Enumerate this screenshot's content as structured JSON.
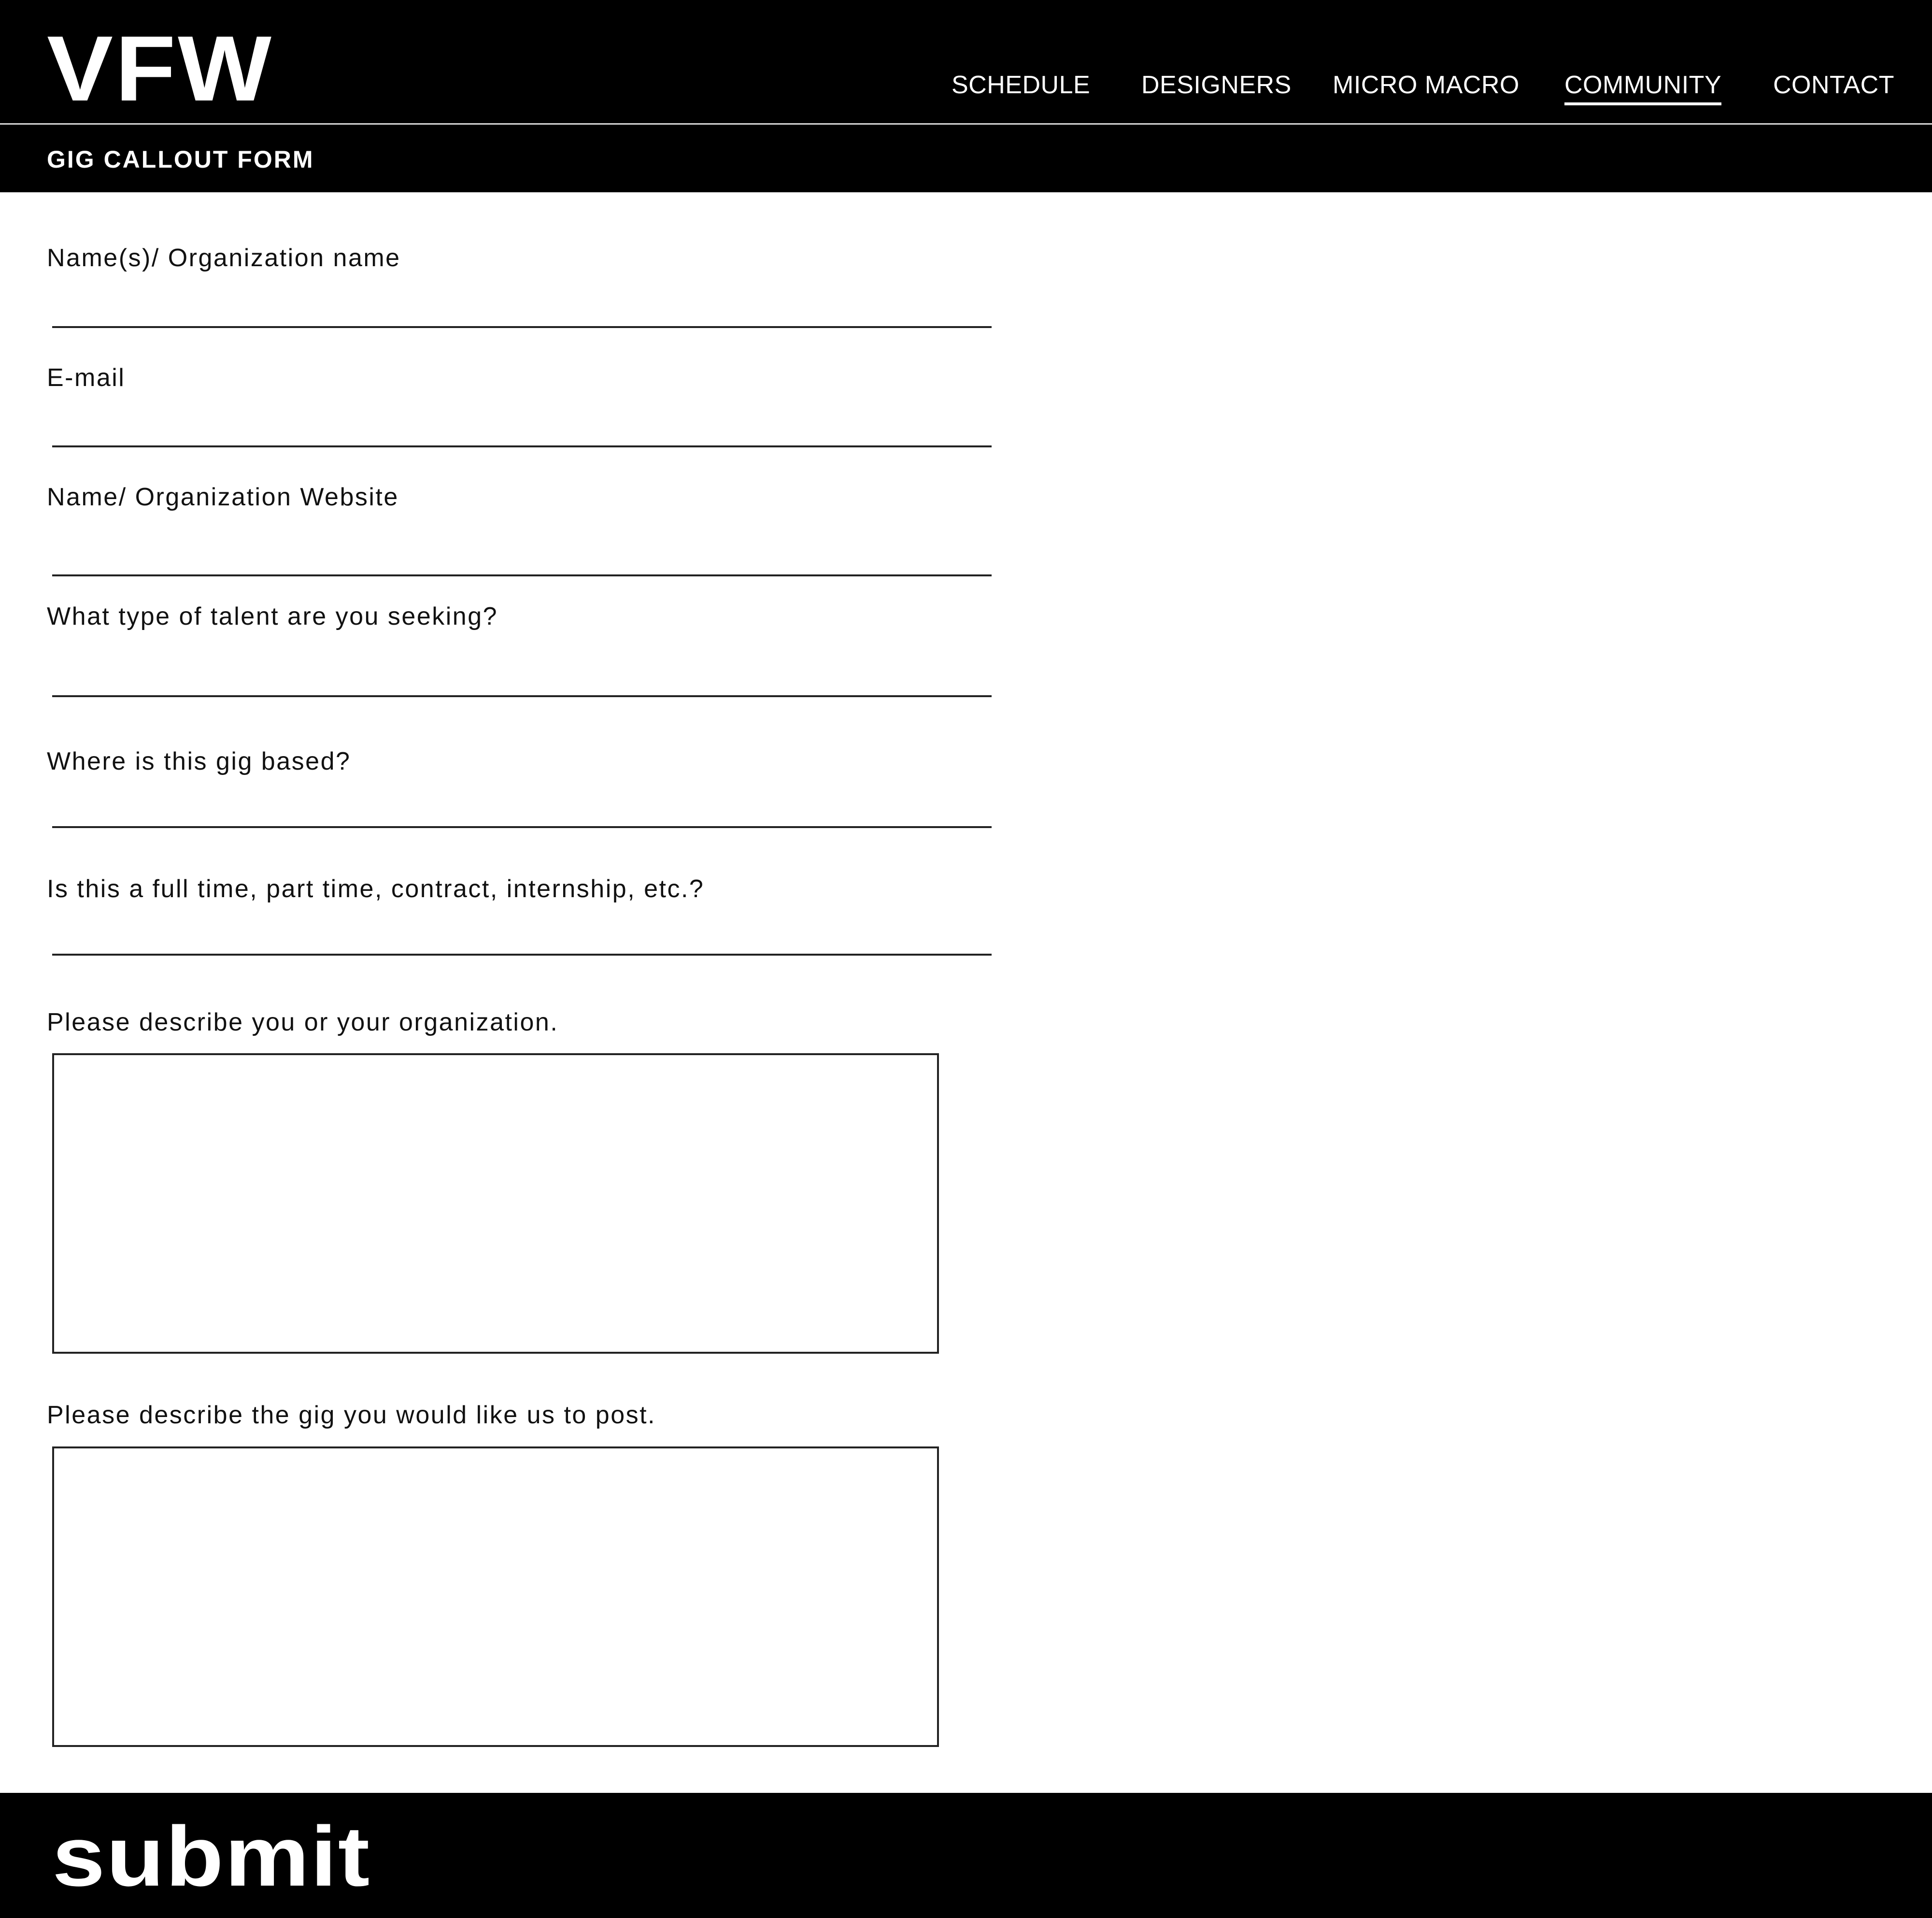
{
  "header": {
    "logo": "VFW",
    "nav": [
      {
        "label": "SCHEDULE",
        "active": false
      },
      {
        "label": "DESIGNERS",
        "active": false
      },
      {
        "label": "MICRO MACRO",
        "active": false
      },
      {
        "label": "COMMUNITY",
        "active": true
      },
      {
        "label": "CONTACT",
        "active": false
      }
    ]
  },
  "page": {
    "title": "GIG CALLOUT FORM"
  },
  "form": {
    "fields": [
      {
        "label": "Name(s)/ Organization name",
        "value": ""
      },
      {
        "label": "E-mail",
        "value": ""
      },
      {
        "label": "Name/ Organization Website",
        "value": ""
      },
      {
        "label": "What type of talent are you seeking?",
        "value": ""
      },
      {
        "label": "Where is this gig based?",
        "value": ""
      },
      {
        "label": "Is this a full time, part time, contract, internship, etc.?",
        "value": ""
      }
    ],
    "textareas": [
      {
        "label": "Please describe you or your organization.",
        "value": ""
      },
      {
        "label": "Please describe the gig you would like us to post.",
        "value": ""
      }
    ],
    "submit_label": "submit"
  },
  "colors": {
    "header_bg": "#000000",
    "header_text": "#ffffff",
    "page_bg": "#ffffff",
    "text": "#111111"
  }
}
